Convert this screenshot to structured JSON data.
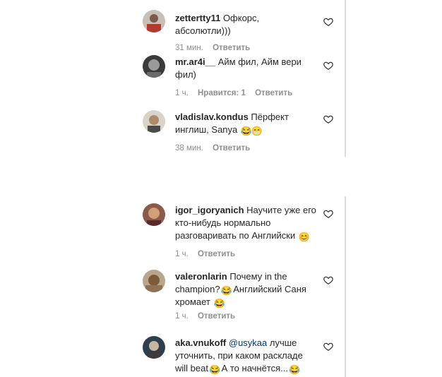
{
  "top_comments": [
    {
      "username": "zettertty11",
      "text": "Офкорс, абсолютли)))",
      "time": "31 мин.",
      "likes": "",
      "reply": "Ответить"
    },
    {
      "username": "mr.ar4i__",
      "text": "Айм фил, Айм вери фил)",
      "time": "1 ч.",
      "likes": "Нравится: 1",
      "reply": "Ответить"
    },
    {
      "username": "vladislav.kondus",
      "text": "Пёрфект инглиш, Sanya",
      "emoji_after": [
        "😂",
        "😁"
      ],
      "time": "38 мин.",
      "likes": "",
      "reply": "Ответить"
    }
  ],
  "bottom_comments": [
    {
      "username": "igor_igoryanich",
      "text": "Научите уже его кто-нибудь нормально разговаривать по Английски",
      "emoji_after": [
        "😊"
      ],
      "time": "1 ч.",
      "likes": "",
      "reply": "Ответить"
    },
    {
      "username": "valeronlarin",
      "text_parts": [
        "Почему in the champion?",
        " Английский Саня хромает"
      ],
      "emojis": [
        "😂",
        "😂"
      ],
      "time": "1 ч.",
      "likes": "",
      "reply": "Ответить"
    },
    {
      "username": "aka.vnukoff",
      "mention": "@usykaa",
      "text_parts": [
        " лучше уточнить, при каком раскладе will beat",
        " А то начнётся..."
      ],
      "emojis": [
        "😂",
        "😂"
      ],
      "time": "",
      "likes": "",
      "reply": ""
    }
  ]
}
